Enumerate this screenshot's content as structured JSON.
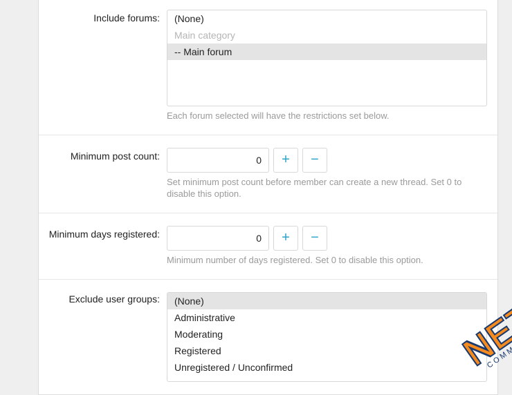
{
  "labels": {
    "include_forums": "Include forums:",
    "min_post_count": "Minimum post count:",
    "min_days_registered": "Minimum days registered:",
    "exclude_user_groups": "Exclude user groups:"
  },
  "include_forums": {
    "options": [
      {
        "text": "(None)",
        "selected": false,
        "disabled": false
      },
      {
        "text": "Main category",
        "selected": false,
        "disabled": true
      },
      {
        "text": "-- Main forum",
        "selected": true,
        "disabled": false
      }
    ],
    "hint": "Each forum selected will have the restrictions set below."
  },
  "min_post_count": {
    "value": "0",
    "plus": "+",
    "minus": "−",
    "hint": "Set minimum post count before member can create a new thread. Set 0 to disable this option."
  },
  "min_days_registered": {
    "value": "0",
    "plus": "+",
    "minus": "−",
    "hint": "Minimum number of days registered. Set 0 to disable this option."
  },
  "exclude_user_groups": {
    "options": [
      {
        "text": "(None)",
        "selected": true
      },
      {
        "text": "Administrative",
        "selected": false
      },
      {
        "text": "Moderating",
        "selected": false
      },
      {
        "text": "Registered",
        "selected": false
      },
      {
        "text": "Unregistered / Unconfirmed",
        "selected": false
      }
    ]
  },
  "watermark": {
    "main": "NET",
    "sub": "COMMUNITY"
  }
}
